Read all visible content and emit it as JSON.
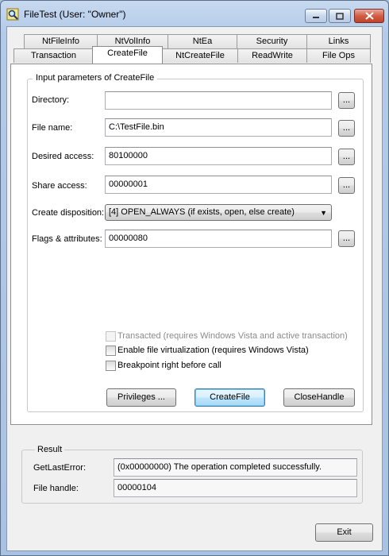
{
  "window": {
    "title": "FileTest (User: \"Owner\")"
  },
  "tabs_row1": [
    "NtFileInfo",
    "NtVolInfo",
    "NtEa",
    "Security",
    "Links"
  ],
  "tabs_row2": [
    "Transaction",
    "CreateFile",
    "NtCreateFile",
    "ReadWrite",
    "File Ops"
  ],
  "input_group": {
    "legend": "Input parameters of CreateFile",
    "directory_label": "Directory:",
    "directory_value": "",
    "filename_label": "File name:",
    "filename_value": "C:\\TestFile.bin",
    "access_label": "Desired access:",
    "access_value": "80100000",
    "share_label": "Share access:",
    "share_value": "00000001",
    "disposition_label": "Create disposition:",
    "disposition_value": "[4] OPEN_ALWAYS (if exists, open, else create)",
    "flags_label": "Flags & attributes:",
    "flags_value": "00000080",
    "browse_label": "..."
  },
  "checkboxes": {
    "transacted": "Transacted (requires Windows Vista and active transaction)",
    "virtualization": "Enable file virtualization (requires Windows Vista)",
    "breakpoint": "Breakpoint right before call"
  },
  "buttons": {
    "privileges": "Privileges ...",
    "createfile": "CreateFile",
    "closehandle": "CloseHandle",
    "exit": "Exit"
  },
  "result": {
    "legend": "Result",
    "lasterror_label": "GetLastError:",
    "lasterror_value": "(0x00000000) The operation completed successfully.",
    "handle_label": "File handle:",
    "handle_value": "00000104"
  }
}
